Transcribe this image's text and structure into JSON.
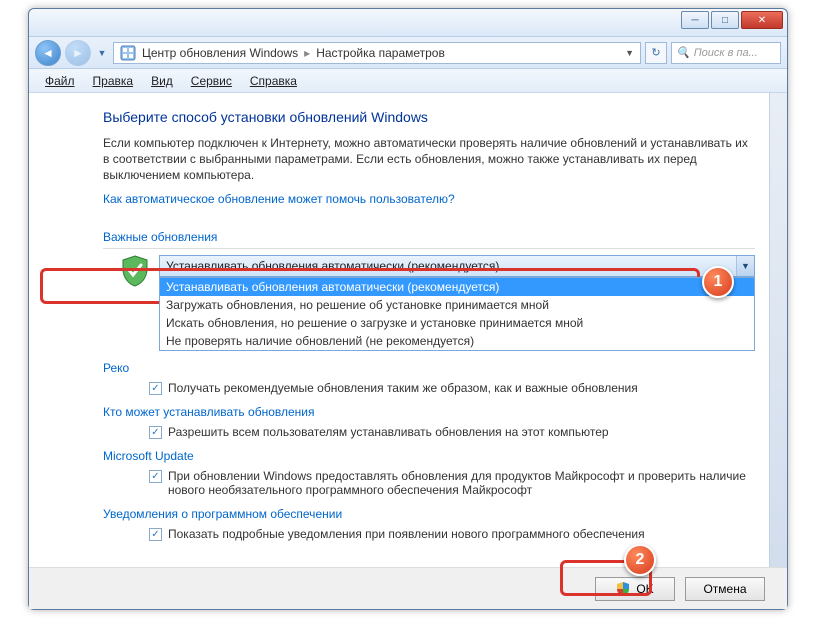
{
  "titlebar": {},
  "nav": {
    "root": "Центр обновления Windows",
    "current": "Настройка параметров",
    "search_placeholder": "Поиск в па..."
  },
  "menu": {
    "file": "Файл",
    "edit": "Правка",
    "view": "Вид",
    "tools": "Сервис",
    "help": "Справка"
  },
  "main": {
    "heading": "Выберите способ установки обновлений Windows",
    "description": "Если компьютер подключен к Интернету, можно автоматически проверять наличие обновлений и устанавливать их в соответствии с выбранными параметрами. Если есть обновления, можно также устанавливать их перед выключением компьютера.",
    "help_link": "Как автоматическое обновление может помочь пользователю?"
  },
  "important": {
    "title": "Важные обновления",
    "selected": "Устанавливать обновления автоматически (рекомендуется)",
    "options": [
      "Устанавливать обновления автоматически (рекомендуется)",
      "Загружать обновления, но решение об установке принимается мной",
      "Искать обновления, но решение о загрузке и установке принимается мной",
      "Не проверять наличие обновлений (не рекомендуется)"
    ]
  },
  "recommended": {
    "title": "Реко",
    "checkbox_label": "Получать рекомендуемые обновления таким же образом, как и важные обновления"
  },
  "who": {
    "title": "Кто может устанавливать обновления",
    "checkbox_label": "Разрешить всем пользователям устанавливать обновления на этот компьютер"
  },
  "msupdate": {
    "title": "Microsoft Update",
    "checkbox_label": "При обновлении Windows предоставлять обновления для продуктов Майкрософт и проверить наличие нового необязательного программного обеспечения Майкрософт"
  },
  "notify": {
    "title": "Уведомления о программном обеспечении",
    "checkbox_label": "Показать подробные уведомления при появлении нового программного обеспечения"
  },
  "footer": {
    "ok": "OK",
    "cancel": "Отмена"
  },
  "badges": {
    "one": "1",
    "two": "2"
  }
}
